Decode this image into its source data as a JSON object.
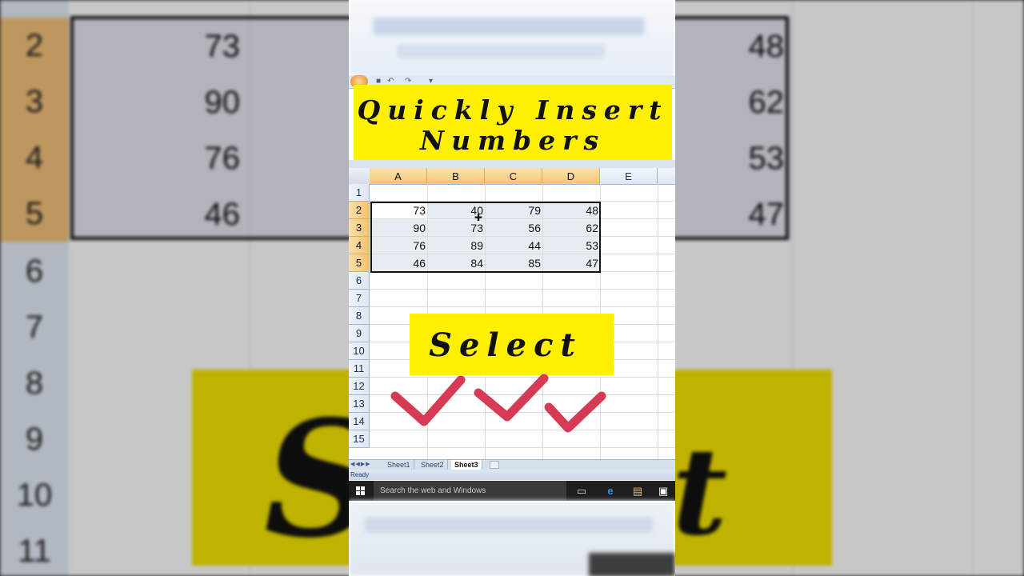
{
  "banner": {
    "line1": "Quickly Insert",
    "line2": "Numbers"
  },
  "columns": [
    "A",
    "B",
    "C",
    "D",
    "E"
  ],
  "rows": [
    "1",
    "2",
    "3",
    "4",
    "5",
    "6",
    "7",
    "8",
    "9",
    "10",
    "11",
    "12",
    "13",
    "14",
    "15"
  ],
  "table": [
    [
      "73",
      "40",
      "79",
      "48"
    ],
    [
      "90",
      "73",
      "56",
      "62"
    ],
    [
      "76",
      "89",
      "44",
      "53"
    ],
    [
      "46",
      "84",
      "85",
      "47"
    ]
  ],
  "background": {
    "rows": [
      "2",
      "3",
      "4",
      "5",
      "6",
      "7",
      "8",
      "9",
      "10",
      "11"
    ],
    "col_a_values": [
      "73",
      "90",
      "76",
      "46"
    ],
    "col_d_values": [
      "48",
      "62",
      "53",
      "47"
    ],
    "big_letter_left": "S",
    "big_letter_right": "t"
  },
  "overlay": {
    "select_label": "Select",
    "check_color": "#d63a55",
    "banner_color": "#ffef00"
  },
  "sheet_tabs": [
    "Sheet1",
    "Sheet2",
    "Sheet3"
  ],
  "active_sheet": "Sheet3",
  "status": {
    "text": "Ready"
  },
  "taskbar": {
    "search_placeholder": "Search the web and Windows"
  },
  "icons": {
    "office_button": "office-button-icon",
    "save": "save-icon",
    "undo": "undo-icon",
    "redo": "redo-icon",
    "task_view": "task-view-icon",
    "edge": "edge-browser-icon",
    "explorer": "file-explorer-icon",
    "store": "store-icon"
  }
}
